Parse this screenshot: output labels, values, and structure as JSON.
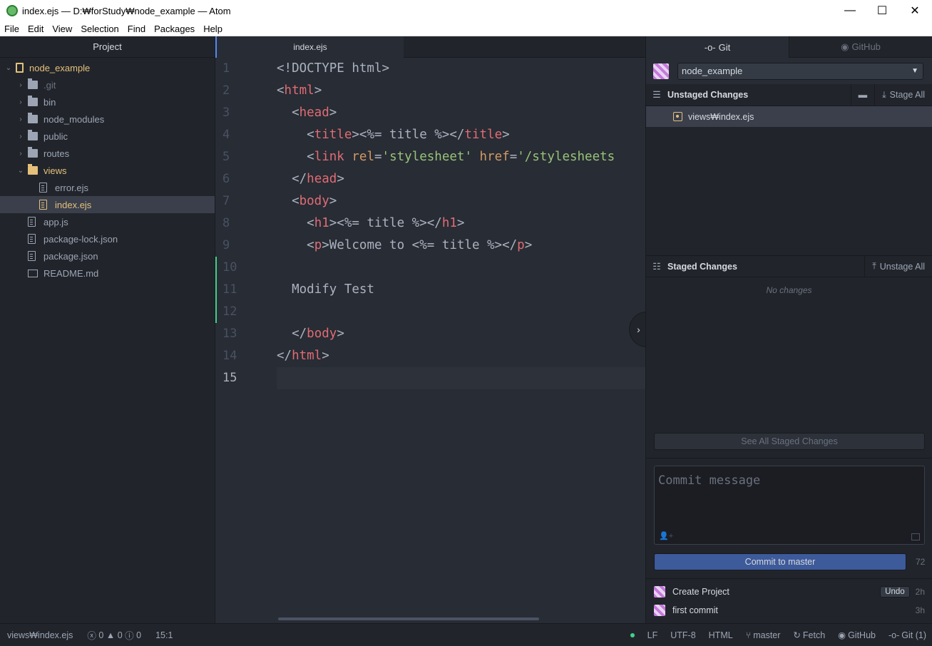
{
  "window": {
    "title": "index.ejs — D:₩forStudy₩node_example — Atom",
    "min": "—",
    "max": "☐",
    "close": "✕"
  },
  "menu": [
    "File",
    "Edit",
    "View",
    "Selection",
    "Find",
    "Packages",
    "Help"
  ],
  "tree": {
    "header": "Project",
    "root": "node_example",
    "items": [
      {
        "label": ".git",
        "type": "folder",
        "depth": 1
      },
      {
        "label": "bin",
        "type": "folder",
        "depth": 1
      },
      {
        "label": "node_modules",
        "type": "folder",
        "depth": 1
      },
      {
        "label": "public",
        "type": "folder",
        "depth": 1
      },
      {
        "label": "routes",
        "type": "folder",
        "depth": 1
      },
      {
        "label": "views",
        "type": "folder-open",
        "depth": 1
      },
      {
        "label": "error.ejs",
        "type": "file",
        "depth": 2
      },
      {
        "label": "index.ejs",
        "type": "file",
        "depth": 2,
        "selected": true
      },
      {
        "label": "app.js",
        "type": "file",
        "depth": 1
      },
      {
        "label": "package-lock.json",
        "type": "file",
        "depth": 1
      },
      {
        "label": "package.json",
        "type": "file",
        "depth": 1
      },
      {
        "label": "README.md",
        "type": "book",
        "depth": 1
      }
    ]
  },
  "editor": {
    "tab": "index.ejs",
    "lines": [
      "<!DOCTYPE html>",
      "<html>",
      "  <head>",
      "    <title><%= title %></title>",
      "    <link rel='stylesheet' href='/stylesheets",
      "  </head>",
      "  <body>",
      "    <h1><%= title %></h1>",
      "    <p>Welcome to <%= title %></p>",
      "",
      "  Modify Test",
      "",
      "  </body>",
      "</html>",
      ""
    ],
    "line_numbers": [
      "1",
      "2",
      "3",
      "4",
      "5",
      "6",
      "7",
      "8",
      "9",
      "10",
      "11",
      "12",
      "13",
      "14",
      "15"
    ],
    "current_line": 15,
    "modified_lines": [
      10,
      11,
      12
    ]
  },
  "git": {
    "tab_git": "Git",
    "tab_github": "GitHub",
    "repo": "node_example",
    "unstaged_title": "Unstaged Changes",
    "stage_all": "Stage All",
    "unstaged_files": [
      "views₩index.ejs"
    ],
    "staged_title": "Staged Changes",
    "unstage_all": "Unstage All",
    "no_changes": "No changes",
    "see_all": "See All Staged Changes",
    "commit_placeholder": "Commit message",
    "commit_button": "Commit to master",
    "char_count": "72",
    "recent_commits": [
      {
        "message": "Create Project",
        "time": "2h",
        "undo": "Undo"
      },
      {
        "message": "first commit",
        "time": "3h"
      }
    ]
  },
  "status": {
    "file": "views₩index.ejs",
    "errors": "0",
    "warnings": "0",
    "infos": "0",
    "cursor": "15:1",
    "line_ending": "LF",
    "encoding": "UTF-8",
    "grammar": "HTML",
    "branch": "master",
    "fetch": "Fetch",
    "github": "GitHub",
    "git": "Git (1)"
  }
}
